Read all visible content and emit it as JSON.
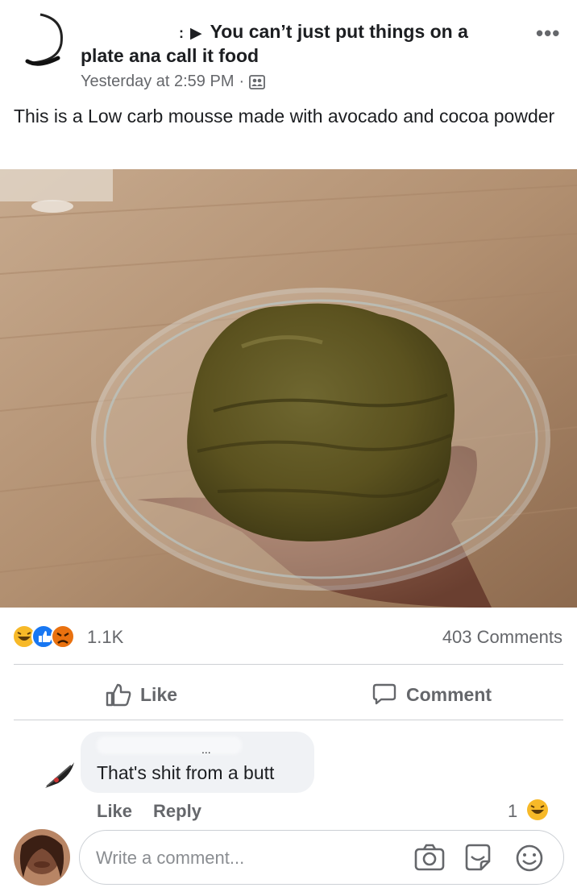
{
  "post": {
    "group_prefix": ":",
    "group_name_line1": "You can’t just put things on a",
    "group_name_line2": "plate ana call it food",
    "timestamp": "Yesterday at 2:59 PM",
    "meta_separator": "·",
    "more_label": "•••",
    "text": "This is a Low carb mousse made with avocado and cocoa powder"
  },
  "stats": {
    "reaction_count": "1.1K",
    "comments_count": "403 Comments",
    "reaction_icons": [
      "haha-icon",
      "like-icon",
      "angry-icon"
    ]
  },
  "actions": {
    "like_label": "Like",
    "comment_label": "Comment"
  },
  "comment": {
    "name_suffix": "...",
    "text": "That's shit from a butt",
    "like_label": "Like",
    "reply_label": "Reply",
    "reaction_count": "1"
  },
  "composer": {
    "placeholder": "Write a comment..."
  },
  "colors": {
    "text": "#1c1e21",
    "secondary": "#65676b",
    "bubble": "#f0f2f5",
    "like_blue": "#1877f2",
    "haha_yellow": "#f7b928",
    "angry_orange": "#e9710f"
  }
}
